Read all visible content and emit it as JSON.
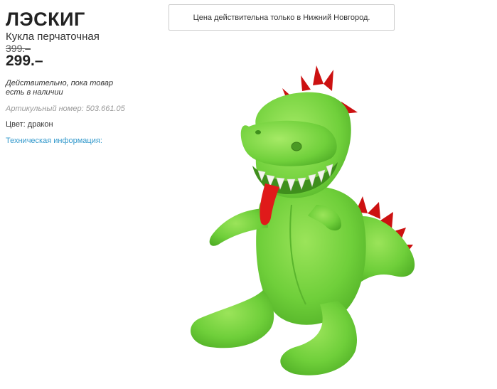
{
  "product": {
    "name": "ЛЭСКИГ",
    "type": "Кукла перчаточная",
    "old_price": "399.–",
    "new_price": "299.–",
    "availability": "Действительно, пока товар есть в наличии",
    "article_label": "Артикульный номер:",
    "article_number": "503.661.05",
    "color_label": "Цвет:",
    "color_value": "дракон",
    "tech_info_link": "Техническая информация:"
  },
  "notice": {
    "text": "Цена действительна только в Нижний Новгород."
  },
  "image": {
    "subject": "green-dragon-hand-puppet",
    "colors": {
      "body": "#6fcf3a",
      "spikes": "#cc1111",
      "tongue": "#e01a1a",
      "teeth": "#f4f4ee"
    }
  }
}
